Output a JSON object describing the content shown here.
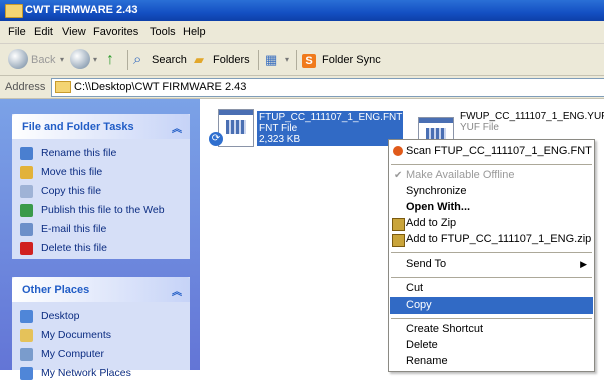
{
  "window": {
    "title": "CWT FIRMWARE 2.43"
  },
  "menu": [
    "File",
    "Edit",
    "View",
    "Favorites",
    "Tools",
    "Help"
  ],
  "toolbar": {
    "back": "Back",
    "search": "Search",
    "folders": "Folders",
    "folder_sync": "Folder Sync"
  },
  "address": {
    "label": "Address",
    "path": "C:\\\\Desktop\\CWT FIRMWARE 2.43"
  },
  "tasks": {
    "title": "File and Folder Tasks",
    "items": [
      {
        "label": "Rename this file",
        "icon": "rename-icon",
        "color": "#4a7fd0"
      },
      {
        "label": "Move this file",
        "icon": "move-icon",
        "color": "#e2b23a"
      },
      {
        "label": "Copy this file",
        "icon": "copy-icon",
        "color": "#9fb3d6"
      },
      {
        "label": "Publish this file to the Web",
        "icon": "globe-icon",
        "color": "#3a9a4a"
      },
      {
        "label": "E-mail this file",
        "icon": "email-icon",
        "color": "#6c8fc9"
      },
      {
        "label": "Delete this file",
        "icon": "delete-icon",
        "color": "#d02020"
      }
    ]
  },
  "places": {
    "title": "Other Places",
    "items": [
      {
        "label": "Desktop",
        "icon": "desktop-icon",
        "color": "#4f86d8"
      },
      {
        "label": "My Documents",
        "icon": "folder-icon",
        "color": "#e5c25a"
      },
      {
        "label": "My Computer",
        "icon": "computer-icon",
        "color": "#7a9ccc"
      },
      {
        "label": "My Network Places",
        "icon": "network-icon",
        "color": "#4f86d8"
      }
    ]
  },
  "files": [
    {
      "name": "FTUP_CC_111107_1_ENG.FNT",
      "type": "FNT File",
      "size": "2,323 KB",
      "selected": true
    },
    {
      "name": "FWUP_CC_111107_1_ENG.YUF",
      "type": "YUF File",
      "size": "",
      "selected": false
    }
  ],
  "context_menu": {
    "scan": "Scan FTUP_CC_111107_1_ENG.FNT",
    "offline": "Make Available Offline",
    "sync": "Synchronize",
    "open_with": "Open With...",
    "add_zip": "Add to Zip",
    "add_named_zip": "Add to FTUP_CC_111107_1_ENG.zip",
    "send_to": "Send To",
    "cut": "Cut",
    "copy": "Copy",
    "shortcut": "Create Shortcut",
    "delete": "Delete",
    "rename": "Rename"
  },
  "colors": {
    "accent": "#316ac5",
    "title_bar": "#1450c3",
    "task_text": "#0c2d82"
  }
}
